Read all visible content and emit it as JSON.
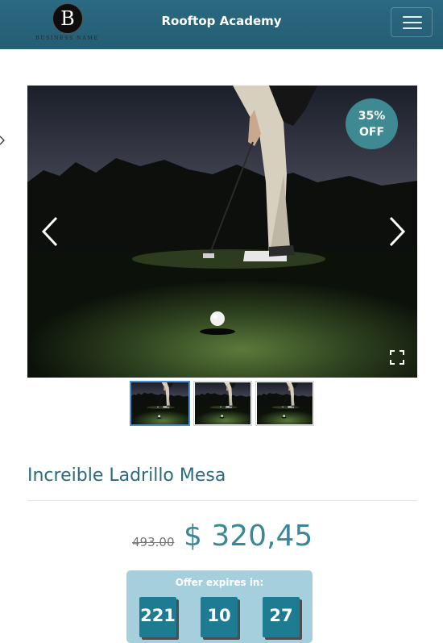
{
  "navbar": {
    "logo_letter": "B",
    "logo_text": "BUSINESS NAME",
    "brand": "Rooftop Academy",
    "menu_icon": "hamburger-icon"
  },
  "product": {
    "discount_line1": "35%",
    "discount_line2": "OFF",
    "title": "Increible Ladrillo Mesa",
    "old_price": "493.00",
    "price": "$ 320,45"
  },
  "gallery": {
    "prev_icon": "chevron-left-icon",
    "next_icon": "chevron-right-icon",
    "fullscreen_icon": "fullscreen-icon",
    "thumbnail_count": 3,
    "active_thumbnail": 1
  },
  "offer": {
    "label": "Offer expires in:",
    "counters": [
      "221",
      "10",
      "27"
    ]
  },
  "colors": {
    "navbar": "#2a6a82",
    "accent": "#3a8797",
    "badge": "#3f8992",
    "offer_box": "#a5cfdc",
    "counter": "#1d7b92"
  }
}
